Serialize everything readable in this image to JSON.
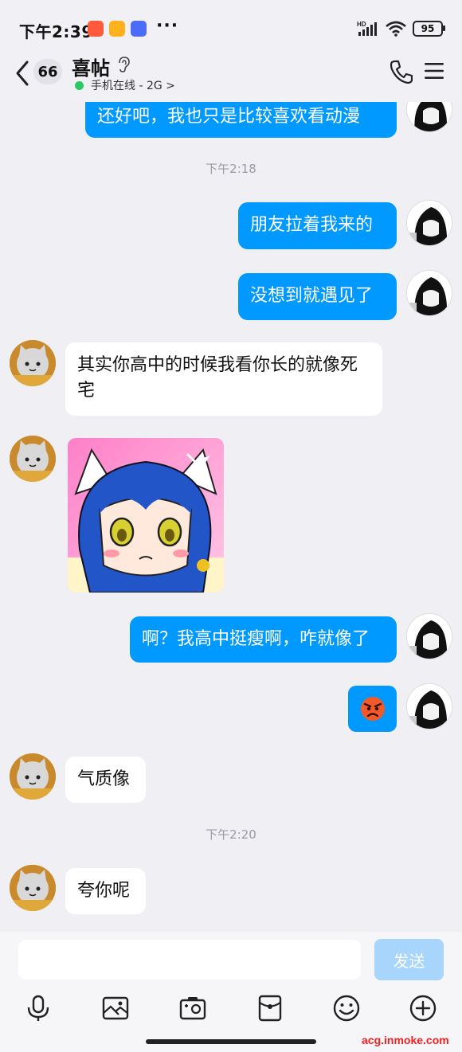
{
  "status_bar": {
    "time": "下午2:39",
    "battery": "95",
    "more": "···",
    "hd_label": "HD"
  },
  "header": {
    "unread_count": "66",
    "contact_name": "喜帖",
    "status": "手机在线 - 2G >"
  },
  "messages": [
    {
      "side": "me",
      "text": "还好吧，我也只是比较喜欢看动漫"
    },
    {
      "timestamp": "下午2:18"
    },
    {
      "side": "me",
      "text": "朋友拉着我来的"
    },
    {
      "side": "me",
      "text": "没想到就遇见了"
    },
    {
      "side": "them",
      "text": "其实你高中的时候我看你长的就像死宅"
    },
    {
      "side": "them",
      "sticker": "anime-girl-sticker"
    },
    {
      "side": "me",
      "text": "啊？我高中挺瘦啊，咋就像了"
    },
    {
      "side": "me",
      "emoji": "angry-face"
    },
    {
      "side": "them",
      "text": "气质像"
    },
    {
      "timestamp": "下午2:20"
    },
    {
      "side": "them",
      "text": "夸你呢"
    }
  ],
  "input": {
    "value": "",
    "send_label": "发送"
  },
  "toolbar": [
    "microphone-icon",
    "image-icon",
    "camera-icon",
    "red-packet-icon",
    "emoji-icon",
    "plus-icon"
  ],
  "watermark": "acg.inmoke.com",
  "colors": {
    "my_bubble": "#0099ff",
    "their_bubble": "#ffffff",
    "background": "#efeff4",
    "online": "#2bc864",
    "send_disabled": "#a7d5fb"
  }
}
